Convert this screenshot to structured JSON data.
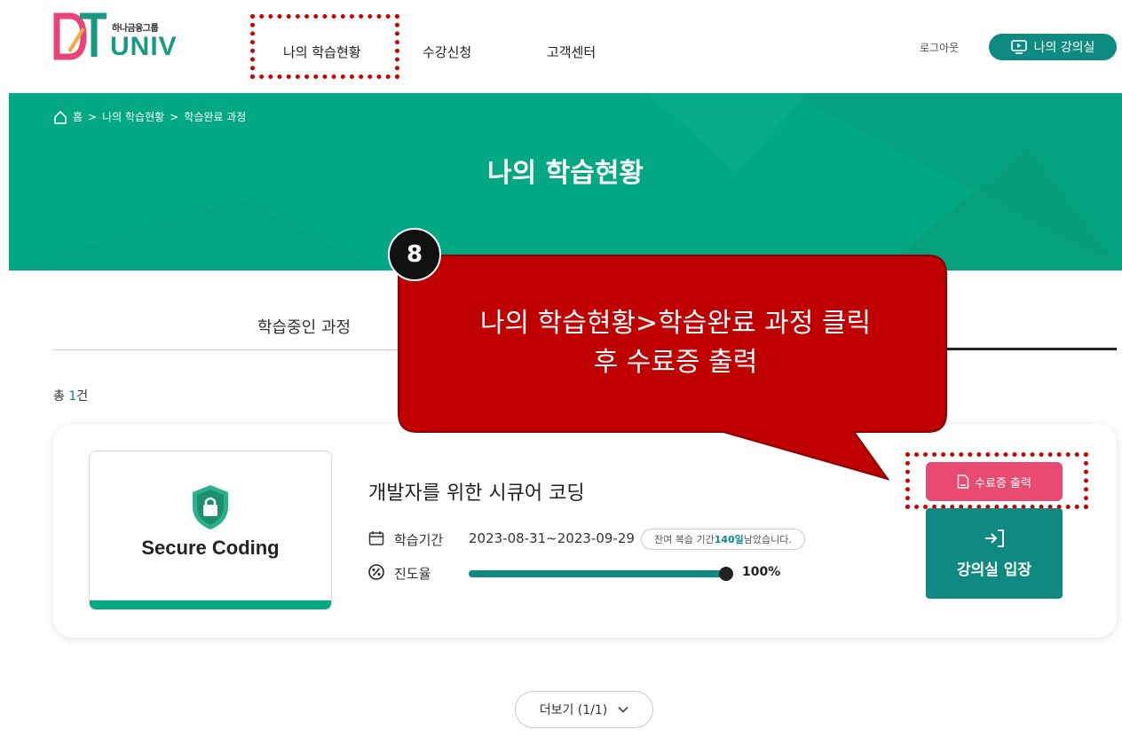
{
  "header": {
    "brand_small": "하나금융그룹",
    "brand_univ": "UNIV",
    "nav": [
      "나의 학습현황",
      "수강신청",
      "고객센터"
    ],
    "logout": "로그아웃",
    "my_classroom": "나의 강의실"
  },
  "hero": {
    "breadcrumb": [
      "홈",
      "나의 학습현황",
      "학습완료 과정"
    ],
    "title": "나의 학습현황"
  },
  "tabs": {
    "active_left": "학습중인 과정"
  },
  "list": {
    "total_prefix": "총 ",
    "total_count": "1",
    "total_suffix": "건"
  },
  "course": {
    "thumb_text": "Secure Coding",
    "title": "개발자를 위한 시큐어 코딩",
    "period_label": "학습기간",
    "period_value": "2023-08-31~2023-09-29",
    "remain_prefix": "잔여 복습 기간 ",
    "remain_days": "140일",
    "remain_suffix": " 남았습니다.",
    "progress_label": "진도율",
    "progress_value": "100%",
    "progress_fraction": 1.0,
    "cert_button": "수료증 출력",
    "enter_button": "강의실 입장"
  },
  "more": {
    "label": "더보기 (1/1)"
  },
  "annotation": {
    "step": "8",
    "line1": "나의 학습현황>학습완료 과정 클릭",
    "line2": "후 수료증 출력"
  },
  "colors": {
    "brand_teal": "#0f8a80",
    "hero_green": "#00a884",
    "cert_pink": "#e84a72",
    "callout_red": "#c00000",
    "highlight_red": "#cc0000"
  }
}
